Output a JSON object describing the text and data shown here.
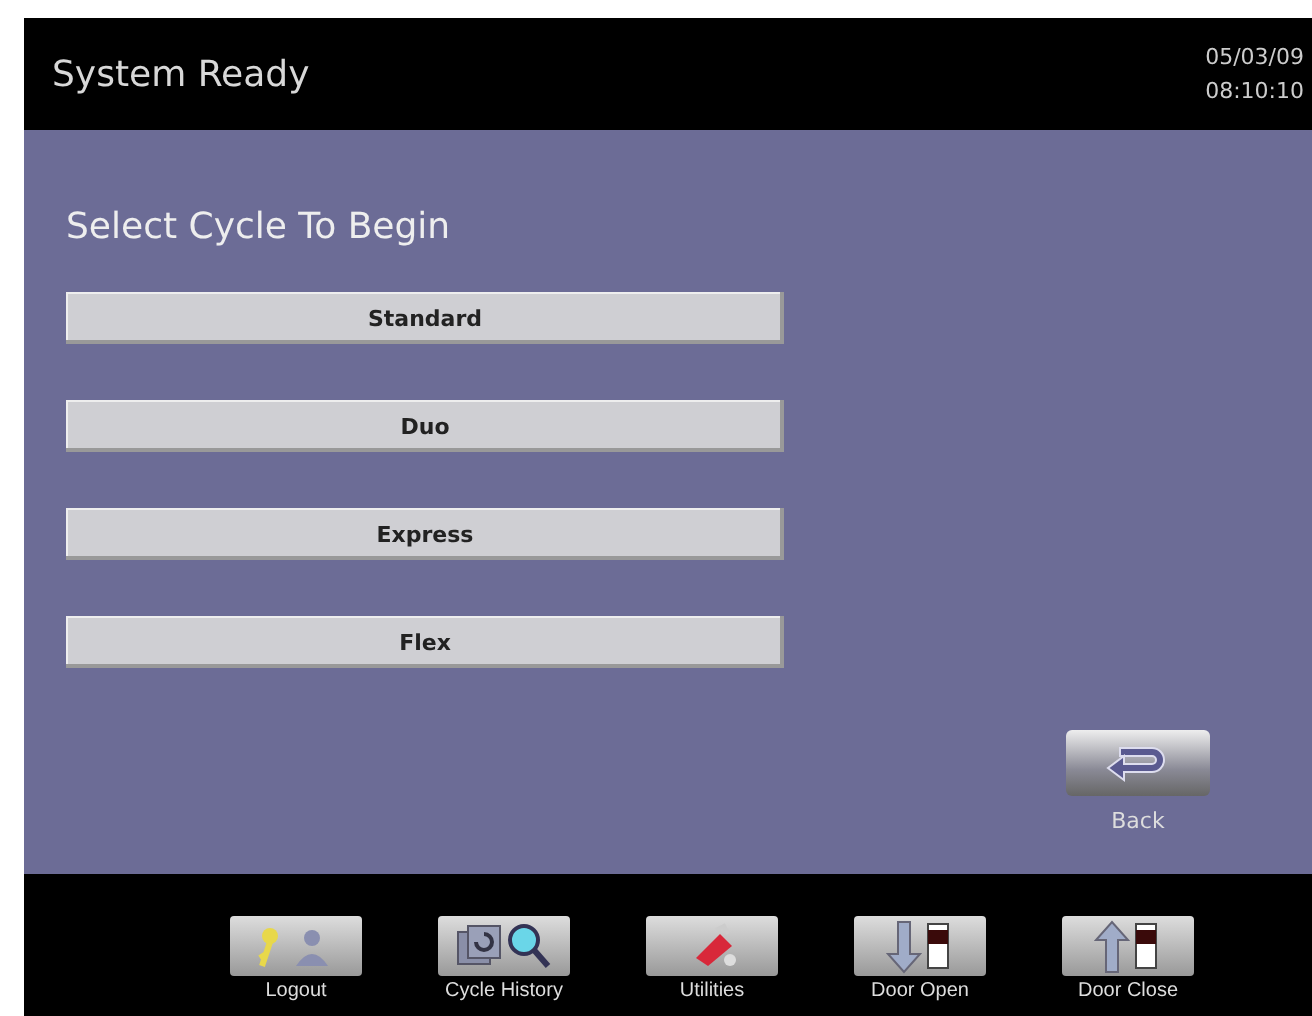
{
  "header": {
    "title": "System Ready",
    "date": "05/03/09",
    "time": "08:10:10"
  },
  "prompt": "Select Cycle To Begin",
  "cycles": [
    {
      "label": "Standard"
    },
    {
      "label": "Duo"
    },
    {
      "label": "Express"
    },
    {
      "label": "Flex"
    }
  ],
  "back": {
    "label": "Back"
  },
  "toolbar": [
    {
      "kind": "logout",
      "label": "Logout"
    },
    {
      "kind": "history",
      "label": "Cycle History"
    },
    {
      "kind": "utilities",
      "label": "Utilities"
    },
    {
      "kind": "door-open",
      "label": "Door Open"
    },
    {
      "kind": "door-close",
      "label": "Door Close"
    }
  ]
}
